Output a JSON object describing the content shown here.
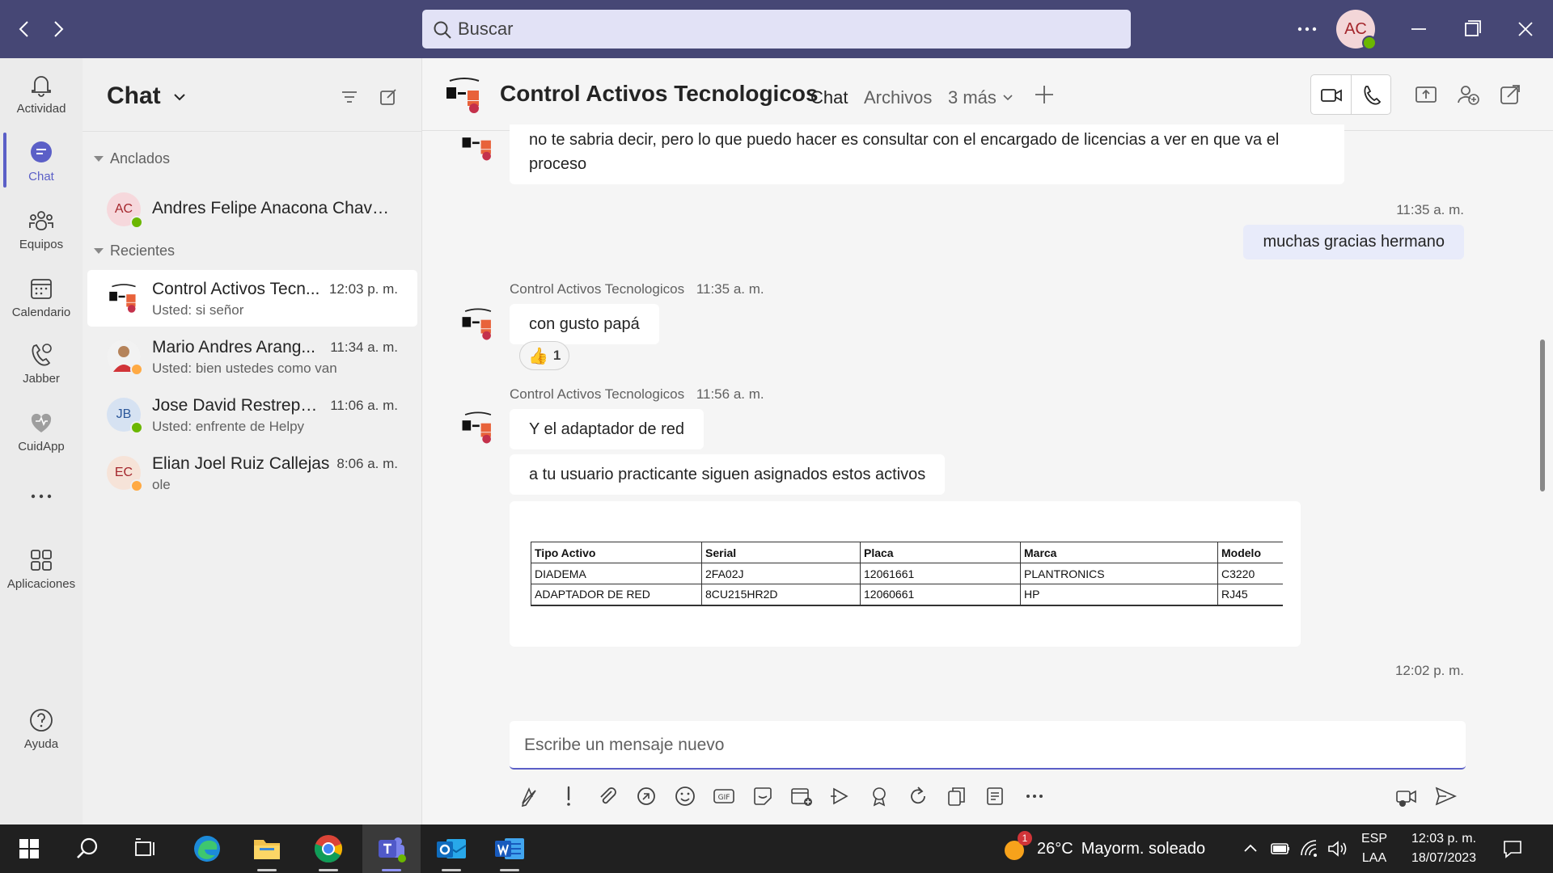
{
  "titlebar": {
    "search_placeholder": "Buscar",
    "user_initials": "AC",
    "accent": "#464775"
  },
  "rail": {
    "items": [
      {
        "label": "Actividad",
        "icon": "bell-icon"
      },
      {
        "label": "Chat",
        "icon": "chat-icon",
        "active": true
      },
      {
        "label": "Equipos",
        "icon": "teams-icon"
      },
      {
        "label": "Calendario",
        "icon": "calendar-icon"
      },
      {
        "label": "Jabber",
        "icon": "jabber-icon"
      },
      {
        "label": "CuidApp",
        "icon": "cuidapp-icon"
      },
      {
        "label": "Aplicaciones",
        "icon": "apps-icon"
      },
      {
        "label": "Ayuda",
        "icon": "help-icon"
      }
    ]
  },
  "chatlist": {
    "title": "Chat",
    "pinned_label": "Anclados",
    "recent_label": "Recientes",
    "pinned": [
      {
        "initials": "AC",
        "name": "Andres Felipe Anacona Chava..."
      }
    ],
    "recent": [
      {
        "name": "Control Activos Tecn...",
        "time": "12:03 p. m.",
        "preview": "Usted: si señor"
      },
      {
        "name": "Mario Andres Arang...",
        "time": "11:34 a. m.",
        "preview": "Usted: bien ustedes como van"
      },
      {
        "initials": "JB",
        "name": "Jose David Restrepo ...",
        "time": "11:06 a. m.",
        "preview": "Usted: enfrente de Helpy"
      },
      {
        "initials": "EC",
        "name": "Elian Joel Ruiz Callejas",
        "time": "8:06 a. m.",
        "preview": "ole"
      }
    ]
  },
  "conversation": {
    "title": "Control Activos Tecnologicos",
    "tabs": [
      "Chat",
      "Archivos",
      "3 más"
    ],
    "messages": {
      "m1": "no te sabria decir, pero lo que puedo hacer es consultar con el encargado de licencias a ver en que va el proceso",
      "mine1_time": "11:35 a. m.",
      "mine1": "muchas gracias hermano",
      "sender": "Control Activos Tecnologicos",
      "m2_time": "11:35 a. m.",
      "m2": "con gusto papá",
      "m2_reaction_count": "1",
      "m3_time": "11:56 a. m.",
      "m3": "Y el adaptador de red",
      "m4": "a tu usuario practicante siguen asignados estos activos",
      "last_time": "12:02 p. m."
    },
    "table": {
      "headers": [
        "Tipo Activo",
        "Serial",
        "Placa",
        "Marca",
        "Modelo"
      ],
      "rows": [
        [
          "DIADEMA",
          "2FA02J",
          "12061661",
          "PLANTRONICS",
          "C3220"
        ],
        [
          "ADAPTADOR DE RED",
          "8CU215HR2D",
          "12060661",
          "HP",
          "RJ45"
        ]
      ]
    },
    "compose_placeholder": "Escribe un mensaje nuevo"
  },
  "taskbar": {
    "weather_temp": "26°C",
    "weather_text": "Mayorm. soleado",
    "weather_badge": "1",
    "lang": "ESP",
    "layout": "LAA",
    "time": "12:03 p. m.",
    "date": "18/07/2023"
  }
}
